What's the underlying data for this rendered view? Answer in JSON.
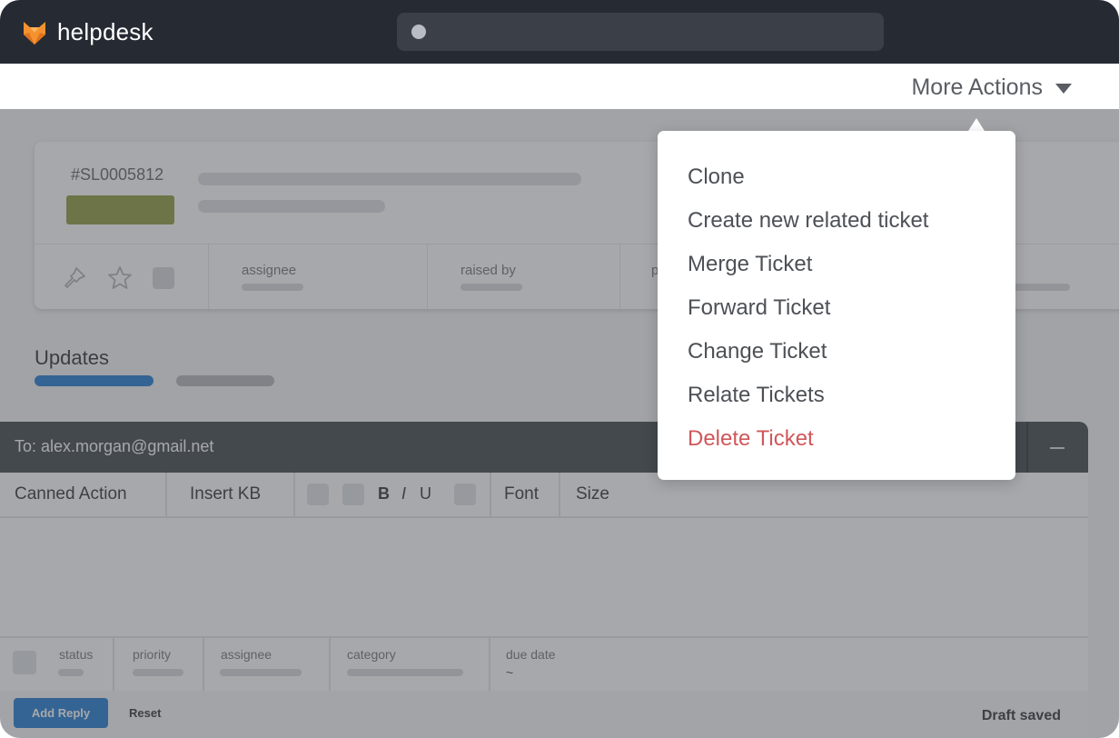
{
  "app": {
    "brand": "helpdesk",
    "logo_icon": "fox-logo-icon"
  },
  "colors": {
    "topbar": "#262b33",
    "accent_blue": "#2f84d4",
    "status_pill": "#95a34c",
    "danger": "#d0575b",
    "composer_head": "#4b5257"
  },
  "search": {
    "placeholder": ""
  },
  "actions": {
    "more_actions_label": "More Actions"
  },
  "dropdown": {
    "items": [
      {
        "label": "Clone"
      },
      {
        "label": "Create new related ticket"
      },
      {
        "label": "Merge Ticket"
      },
      {
        "label": "Forward Ticket"
      },
      {
        "label": "Change Ticket"
      },
      {
        "label": "Relate Tickets"
      },
      {
        "label": "Delete Ticket",
        "danger": true
      }
    ]
  },
  "ticket": {
    "id": "#SL0005812",
    "meta": [
      {
        "label": "assignee"
      },
      {
        "label": "raised by"
      },
      {
        "label": "p"
      }
    ]
  },
  "tabs": {
    "updates_label": "Updates"
  },
  "composer": {
    "to": "To: alex.morgan@gmail.net",
    "toolbar": {
      "canned_action": "Canned Action",
      "insert_kb": "Insert KB",
      "bold": "B",
      "italic": "I",
      "underline": "U",
      "font": "Font",
      "size": "Size"
    },
    "fields": {
      "status": "status",
      "priority": "priority",
      "assignee": "assignee",
      "category": "category",
      "due_date": "due date",
      "due_date_value": "~"
    },
    "footer": {
      "add_reply": "Add Reply",
      "reset": "Reset",
      "draft_status": "Draft saved"
    }
  }
}
